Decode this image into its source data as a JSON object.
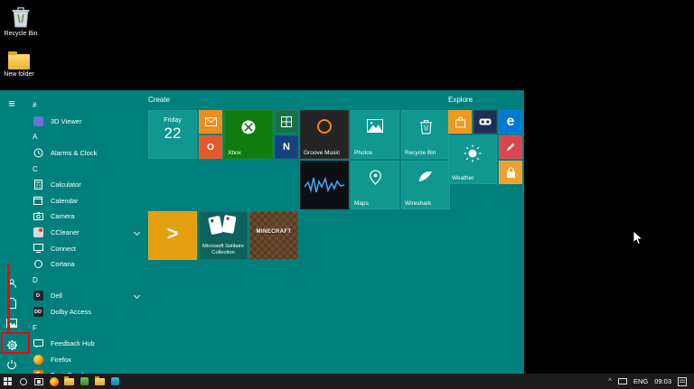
{
  "desktop": {
    "icons": [
      {
        "label": "Recycle Bin"
      },
      {
        "label": "New folder"
      }
    ]
  },
  "start_menu": {
    "groups": {
      "create": "Create",
      "explore": "Explore"
    },
    "app_list": [
      {
        "type": "header",
        "label": "#"
      },
      {
        "type": "app",
        "label": "3D Viewer"
      },
      {
        "type": "header",
        "label": "A"
      },
      {
        "type": "app",
        "label": "Alarms & Clock"
      },
      {
        "type": "header",
        "label": "C"
      },
      {
        "type": "app",
        "label": "Calculator"
      },
      {
        "type": "app",
        "label": "Calendar"
      },
      {
        "type": "app",
        "label": "Camera"
      },
      {
        "type": "app",
        "label": "CCleaner",
        "expandable": true
      },
      {
        "type": "app",
        "label": "Connect"
      },
      {
        "type": "app",
        "label": "Cortana"
      },
      {
        "type": "header",
        "label": "D"
      },
      {
        "type": "app",
        "label": "Dell",
        "expandable": true
      },
      {
        "type": "app",
        "label": "Dolby Access"
      },
      {
        "type": "header",
        "label": "F"
      },
      {
        "type": "app",
        "label": "Feedback Hub"
      },
      {
        "type": "app",
        "label": "Firefox"
      },
      {
        "type": "app",
        "label": "Foxit Reader"
      }
    ],
    "tiles": {
      "calendar": {
        "line1": "Friday",
        "line2": "22"
      },
      "office": {
        "glyph": "O"
      },
      "xbox": {
        "label": "Xbox"
      },
      "onenote": {
        "glyph": "N"
      },
      "groove": {
        "label": "Groove Music"
      },
      "photos": {
        "label": "Photos"
      },
      "recycle_bin": {
        "label": "Recycle Bin"
      },
      "maps": {
        "label": "Maps"
      },
      "wireshark": {
        "label": "Wireshark"
      },
      "plex": {
        "glyph": ">"
      },
      "solitaire": {
        "label": "Microsoft Solitaire Collection"
      },
      "minecraft": {
        "label": "MINECRAFT"
      },
      "edge": {
        "glyph": "e"
      },
      "weather": {
        "label": "Weather"
      }
    }
  },
  "taskbar": {
    "lang": "ENG",
    "time": "09:03"
  },
  "colors": {
    "menu_bg": "#00807d",
    "tile_teal": "#0f9790",
    "xbox_green": "#107c10",
    "annotation_red": "#ff0000"
  }
}
